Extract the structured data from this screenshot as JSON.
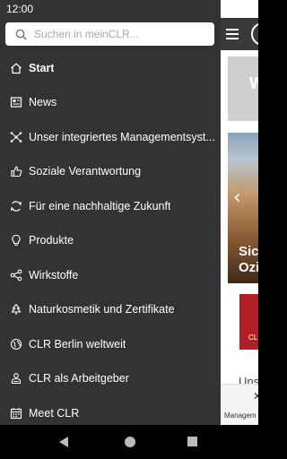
{
  "status_bar": {
    "time": "12:00"
  },
  "search": {
    "placeholder": "Suchen in meinCLR..."
  },
  "menu": {
    "items": [
      {
        "label": "Start",
        "icon": "home-icon",
        "active": true
      },
      {
        "label": "News",
        "icon": "newspaper-icon"
      },
      {
        "label": "Unser integriertes Managementsyst...",
        "icon": "network-icon"
      },
      {
        "label": "Soziale Verantwortung",
        "icon": "thumbs-up-icon"
      },
      {
        "label": "Für eine nachhaltige Zukunft",
        "icon": "recycle-icon"
      },
      {
        "label": "Produkte",
        "icon": "lightbulb-icon"
      },
      {
        "label": "Wirkstoffe",
        "icon": "share-nodes-icon"
      },
      {
        "label": "Naturkosmetik und Zertifikate",
        "icon": "tree-icon"
      },
      {
        "label": "CLR Berlin weltweit",
        "icon": "globe-icon"
      },
      {
        "label": "CLR als Arbeitgeber",
        "icon": "person-badge-icon"
      },
      {
        "label": "Meet CLR",
        "icon": "calendar-icon"
      }
    ]
  },
  "background": {
    "card_letter": "W",
    "photo_caption_1": "Sic",
    "photo_caption_2": "Ozi",
    "red_label": "CL",
    "section_text": "Uns",
    "tab_label": "Managem"
  }
}
